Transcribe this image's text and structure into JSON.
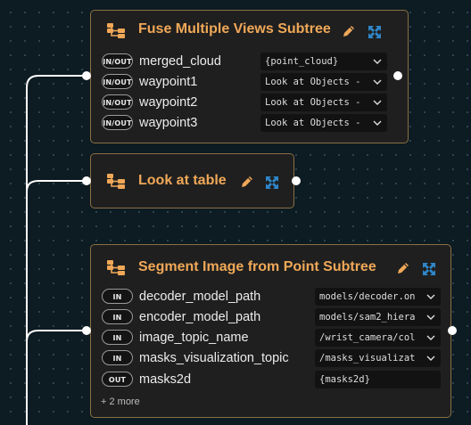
{
  "colors": {
    "accent": "#f0a858",
    "node_border": "#8a7044",
    "node_bg": "#1f1f1f",
    "canvas_bg": "#0d1b22"
  },
  "nodes": [
    {
      "title": "Fuse Multiple Views Subtree",
      "icon": "subtree-icon",
      "params": [
        {
          "badge": "IN/OUT",
          "name": "merged_cloud",
          "value": "{point_cloud}"
        },
        {
          "badge": "IN/OUT",
          "name": "waypoint1",
          "value": "Look at Objects -"
        },
        {
          "badge": "IN/OUT",
          "name": "waypoint2",
          "value": "Look at Objects -"
        },
        {
          "badge": "IN/OUT",
          "name": "waypoint3",
          "value": "Look at Objects -"
        }
      ]
    },
    {
      "title": "Look at table",
      "icon": "subtree-icon",
      "params": []
    },
    {
      "title": "Segment Image from Point Subtree",
      "icon": "subtree-icon",
      "params": [
        {
          "badge": "IN",
          "name": "decoder_model_path",
          "value": "models/decoder.on"
        },
        {
          "badge": "IN",
          "name": "encoder_model_path",
          "value": "models/sam2_hiera"
        },
        {
          "badge": "IN",
          "name": "image_topic_name",
          "value": "/wrist_camera/col"
        },
        {
          "badge": "IN",
          "name": "masks_visualization_topic",
          "value": "/masks_visualizat"
        },
        {
          "badge": "OUT",
          "name": "masks2d",
          "value": "{masks2d}"
        }
      ],
      "more": "+ 2 more"
    }
  ]
}
